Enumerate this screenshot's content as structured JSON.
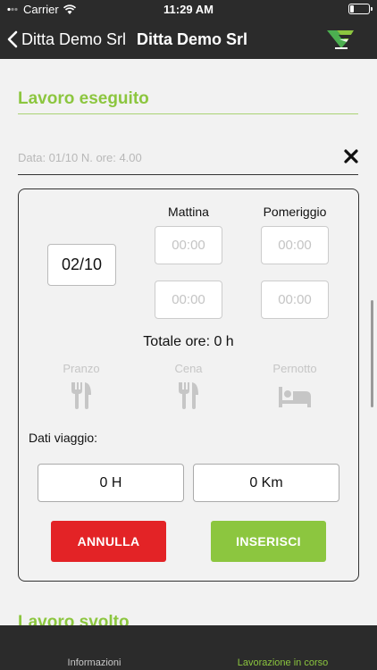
{
  "status_bar": {
    "carrier": "Carrier",
    "time": "11:29 AM"
  },
  "nav": {
    "back_label": "Ditta Demo Srl",
    "title": "Ditta Demo Srl"
  },
  "section": {
    "title": "Lavoro eseguito"
  },
  "summary": {
    "placeholder": "Data: 01/10 N. ore: 4.00"
  },
  "form": {
    "col_morning": "Mattina",
    "col_afternoon": "Pomeriggio",
    "date_value": "02/10",
    "time_placeholder": "00:00",
    "total_label": "Totale ore: 0 h",
    "meals": [
      {
        "label": "Pranzo",
        "icon": "fork-knife-icon"
      },
      {
        "label": "Cena",
        "icon": "fork-knife-icon"
      },
      {
        "label": "Pernotto",
        "icon": "bed-icon"
      }
    ],
    "travel_label": "Dati viaggio:",
    "hours_value": "0 H",
    "km_value": "0 Km",
    "cancel_label": "ANNULLA",
    "insert_label": "INSERISCI"
  },
  "next_section": {
    "title": "Lavoro svolto"
  },
  "tabs": [
    {
      "label": "Informazioni",
      "active": false
    },
    {
      "label": "Lavorazione in corso",
      "active": true
    }
  ],
  "colors": {
    "accent_green": "#8cc63f",
    "danger_red": "#e32326",
    "bar_dark": "#2b2b2b"
  }
}
